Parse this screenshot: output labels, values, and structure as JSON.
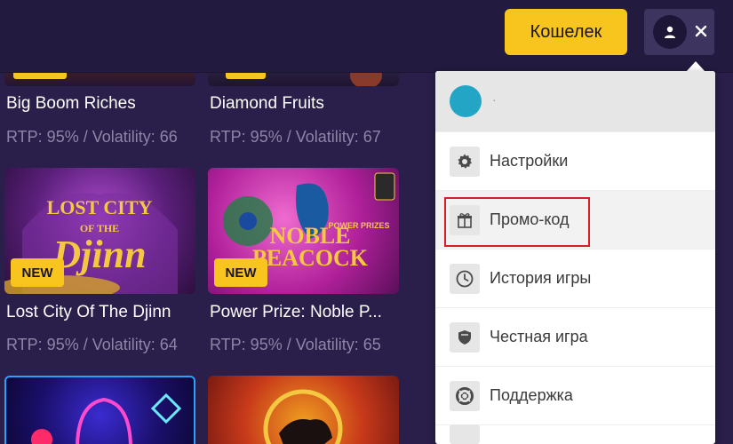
{
  "header": {
    "wallet_label": "Кошелек",
    "user_icon": "user-icon",
    "close_icon": "close-icon"
  },
  "colors": {
    "accent": "#f7c51e",
    "background": "#2a1e4a",
    "menu_avatar": "#23a6c5",
    "highlight": "#d91f26"
  },
  "games": [
    {
      "title": "Big Boom Riches",
      "meta": "RTP: 95% / Volatility: 66",
      "badge": ""
    },
    {
      "title": "Diamond Fruits",
      "meta": "RTP: 95% / Volatility: 67",
      "badge": ""
    },
    {
      "title": "Lost City Of The Djinn",
      "meta": "RTP: 95% / Volatility: 64",
      "badge": "NEW"
    },
    {
      "title": "Power Prize: Noble P...",
      "meta": "RTP: 95% / Volatility: 65",
      "badge": "NEW"
    }
  ],
  "menu": {
    "username": "·",
    "items": [
      {
        "label": "Настройки",
        "icon": "gear-icon"
      },
      {
        "label": "Промо-код",
        "icon": "gift-icon"
      },
      {
        "label": "История игры",
        "icon": "clock-icon"
      },
      {
        "label": "Честная игра",
        "icon": "shield-icon"
      },
      {
        "label": "Поддержка",
        "icon": "lifebuoy-icon"
      }
    ]
  }
}
